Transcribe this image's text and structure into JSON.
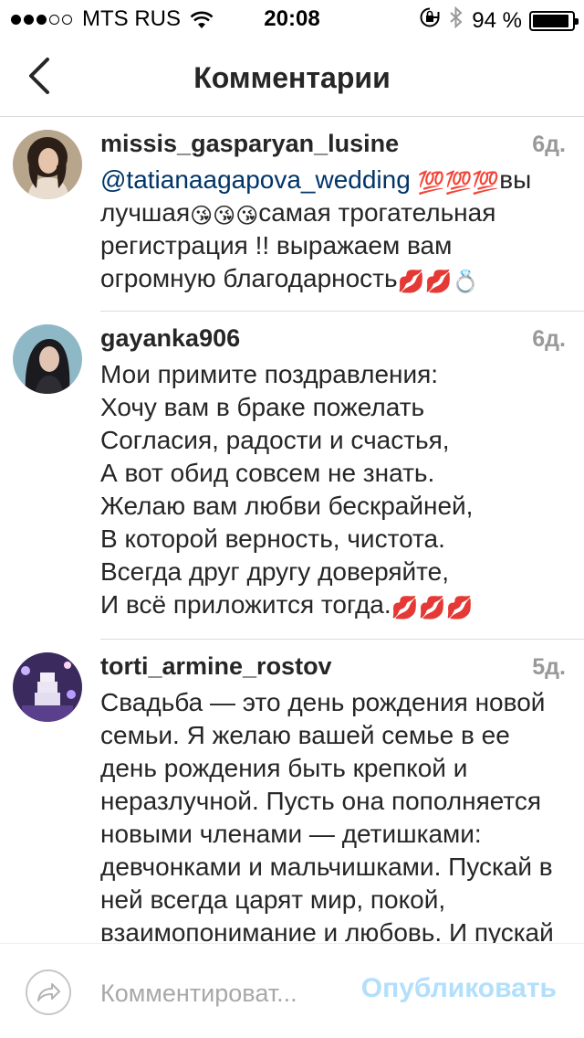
{
  "status_bar": {
    "carrier": "MTS RUS",
    "time": "20:08",
    "battery_percent": "94 %",
    "battery_level": 0.94
  },
  "nav": {
    "title": "Комментарии",
    "back_icon": "chevron-left-icon"
  },
  "comments": [
    {
      "username": "missis_gasparyan_lusine",
      "time": "6д.",
      "mention": "@tatianaagapova_wedding",
      "emoji_100": "💯",
      "text_1": "вы лучшая",
      "emoji_kiss": "😘",
      "text_2": "самая трогательная регистрация !! выражаем вам огромную благодарность",
      "emoji_lips": "💋",
      "emoji_ring": "💍"
    },
    {
      "username": "gayanka906",
      "time": "6д.",
      "lines": [
        "Мои примите поздравления:",
        "Хочу вам в браке пожелать",
        "Согласия, радости и счастья,",
        "А вот обид совсем не знать.",
        "Желаю вам любви бескрайней,",
        "В которой верность, чистота.",
        "Всегда друг другу доверяйте,",
        "И всё приложится тогда."
      ],
      "emoji_lips": "💋"
    },
    {
      "username": "torti_armine_rostov",
      "time": "5д.",
      "text": "Свадьба — это день рождения новой семьи. Я желаю вашей семье в ее день рождения быть крепкой и неразлучной. Пусть она пополняется новыми членами — детишками: девчонками и мальчишками. Пускай в ней всегда царят мир, покой, взаимопонимание и любовь. И пускай у вашей семьи впереди будут"
    }
  ],
  "compose": {
    "placeholder": "Комментироват...",
    "publish_label": "Опубликовать",
    "share_icon": "share-arrow-icon"
  },
  "colors": {
    "mention": "#003569",
    "publish_disabled": "#b2dffc",
    "divider": "#dbdbdb",
    "timestamp": "#999999"
  }
}
